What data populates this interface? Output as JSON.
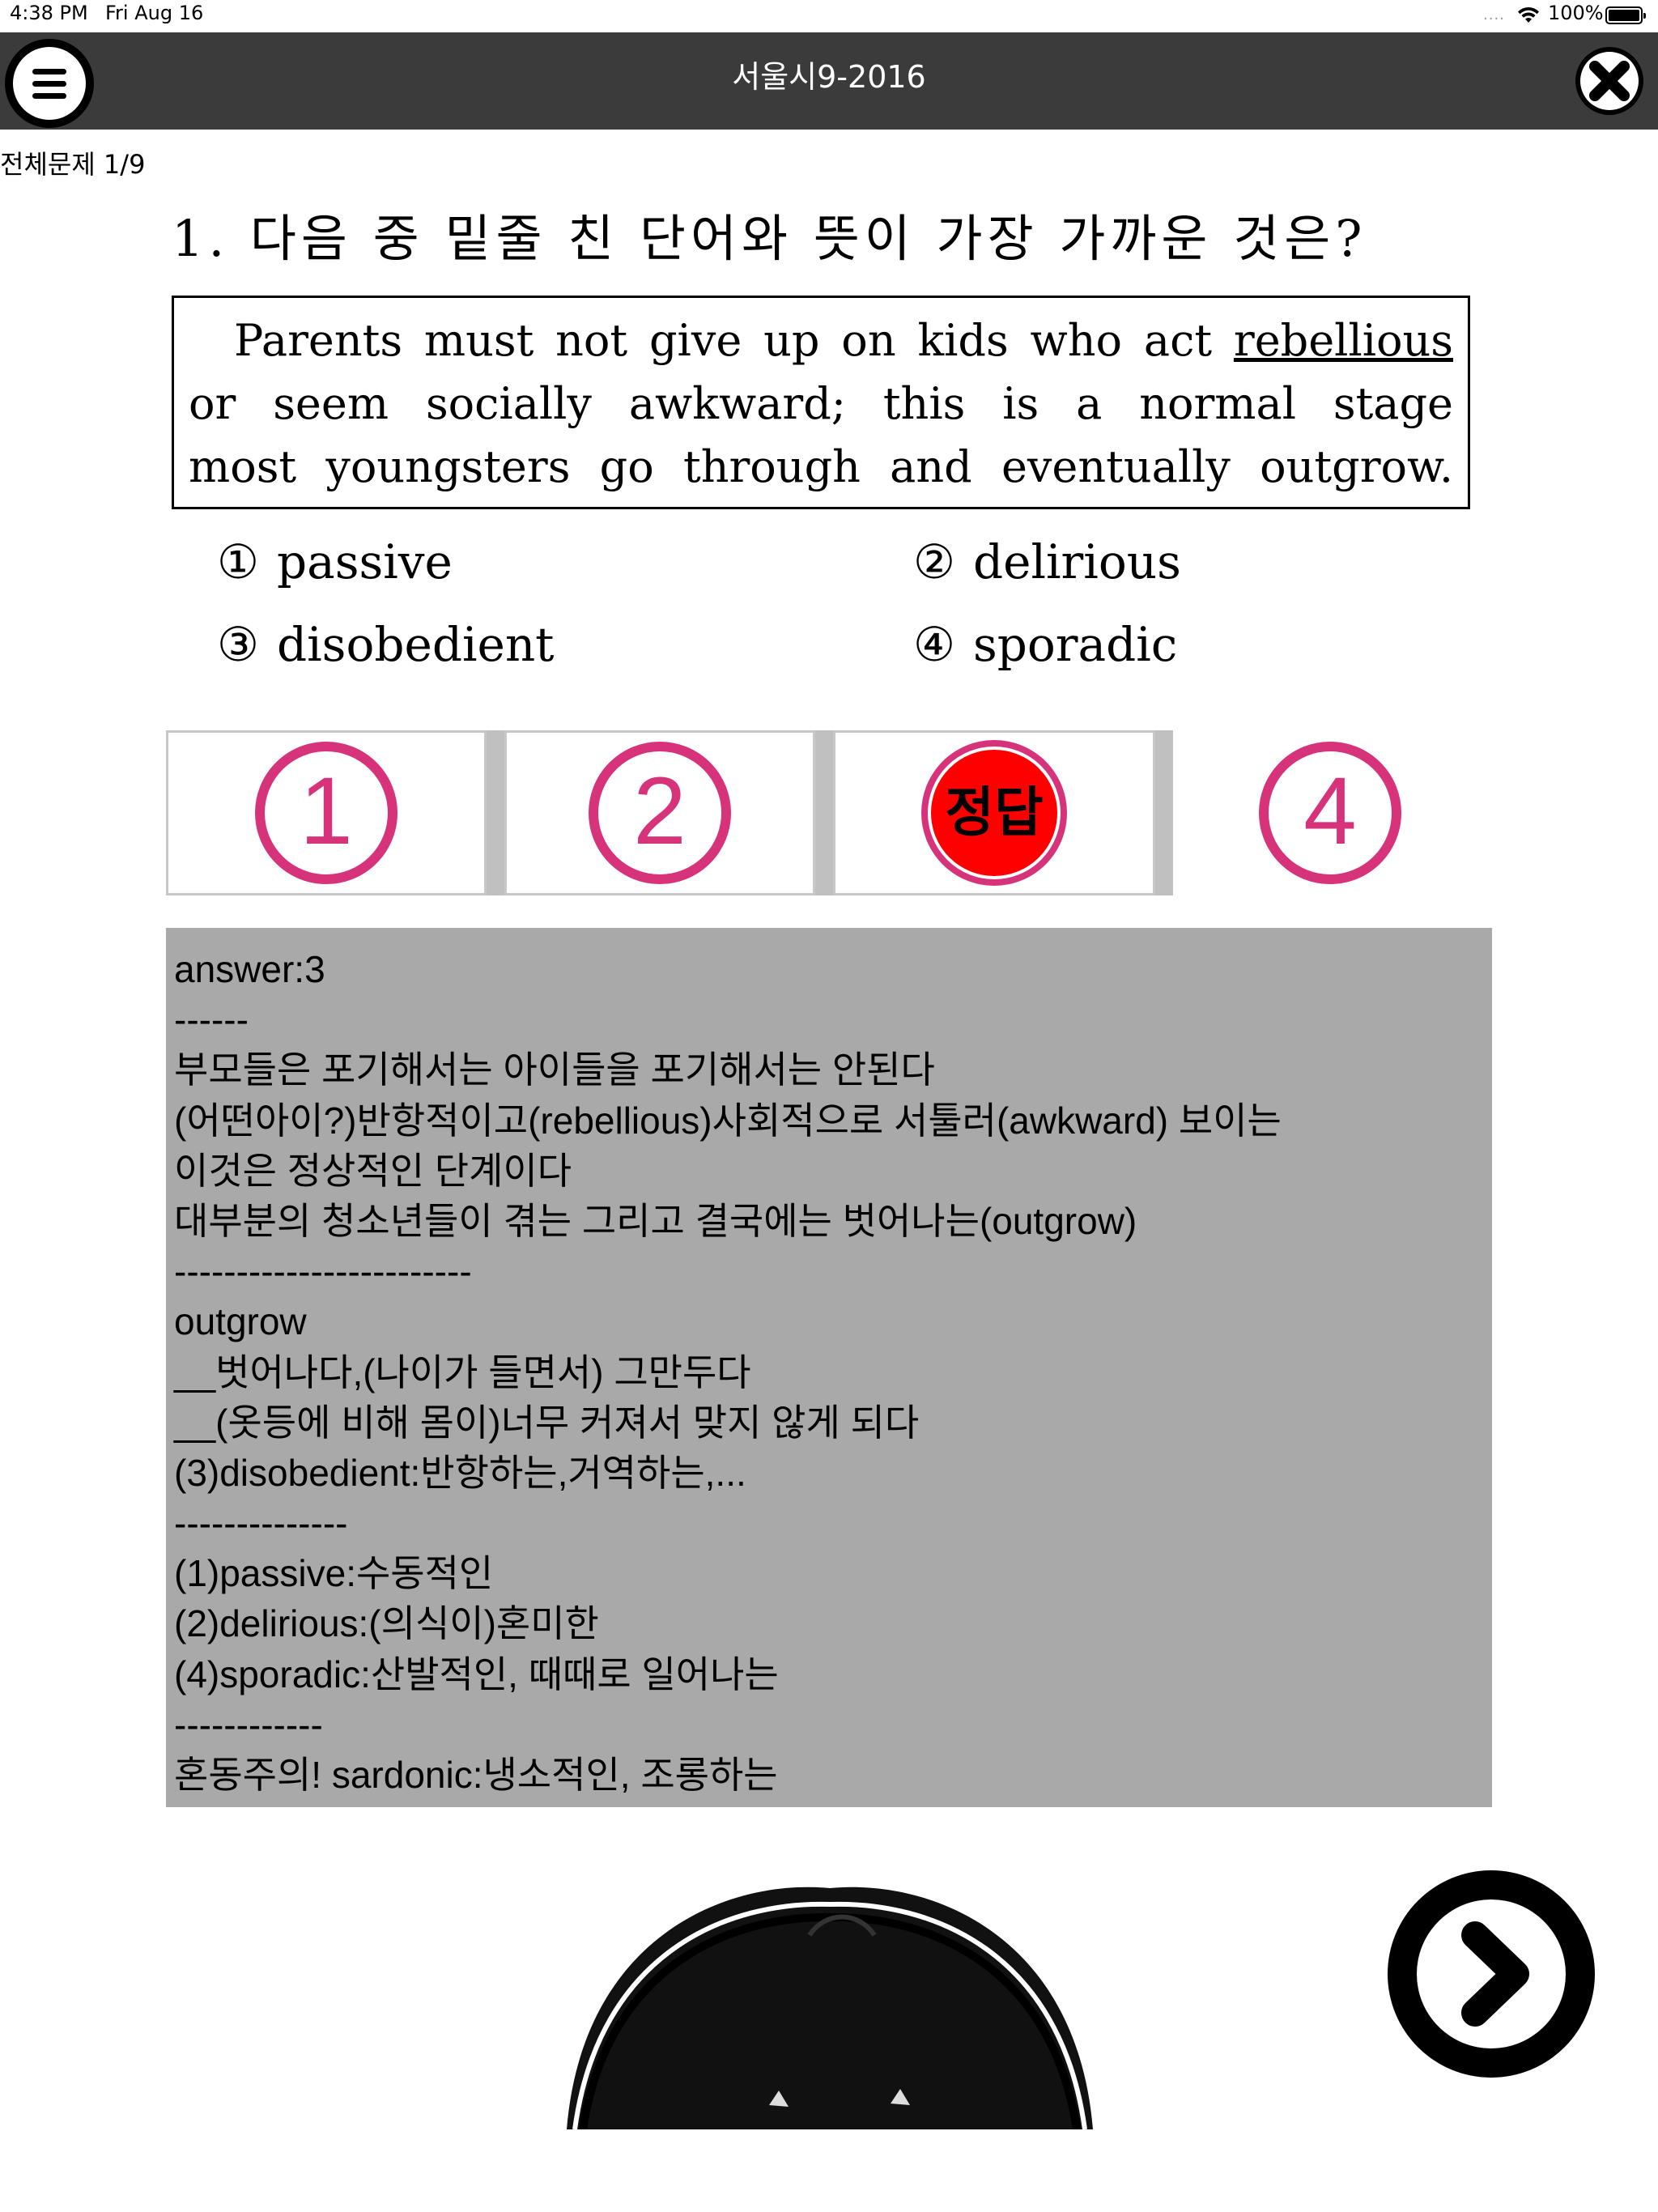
{
  "status_bar": {
    "time": "4:38 PM",
    "date": "Fri Aug 16",
    "signal": "....",
    "battery": "100%"
  },
  "nav": {
    "title": "서울시9-2016"
  },
  "counter": "전체문제 1/9",
  "question": {
    "text": "1. 다음 중 밑줄 친 단어와 뜻이 가장 가까운 것은?",
    "passage": {
      "line1_before": "Parents must not give up on kids who act ",
      "line1_underlined": "rebellious",
      "line2": "or seem socially awkward; this is a normal stage",
      "line3": "most youngsters go through and eventually outgrow."
    },
    "options": [
      {
        "num": "①",
        "text": "passive"
      },
      {
        "num": "②",
        "text": "delirious"
      },
      {
        "num": "③",
        "text": "disobedient"
      },
      {
        "num": "④",
        "text": "sporadic"
      }
    ]
  },
  "answer_buttons": [
    {
      "label": "1"
    },
    {
      "label": "2"
    },
    {
      "label": "정답"
    },
    {
      "label": "4"
    }
  ],
  "colors": {
    "button_magenta": "#d6337a",
    "correct_red": "#ff0000",
    "explain_bg": "#a9a9a9",
    "navbar_bg": "#3b3b3b"
  },
  "explanation": [
    "answer:3",
    "------",
    "부모들은 포기해서는 아이들을 포기해서는 안된다",
    "(어떤아이?)반항적이고(rebellious)사회적으로 서툴러(awkward) 보이는",
    "이것은 정상적인 단계이다",
    "대부분의 청소년들이 겪는 그리고 결국에는 벗어나는(outgrow)",
    "------------------------",
    "outgrow",
    "__벗어나다,(나이가 들면서) 그만두다",
    "__(옷등에 비해 몸이)너무 커져서 맞지 않게 되다",
    "(3)disobedient:반항하는,거역하는,...",
    "--------------",
    "(1)passive:수동적인",
    "(2)delirious:(의식이)혼미한",
    "(4)sporadic:산발적인, 때때로 일어나는",
    "------------",
    "혼동주의! sardonic:냉소적인, 조롱하는"
  ],
  "icons": {
    "menu": "hamburger-menu-icon",
    "close": "close-x-icon",
    "next": "chevron-right-icon",
    "wifi": "wifi-icon",
    "battery": "battery-icon"
  }
}
